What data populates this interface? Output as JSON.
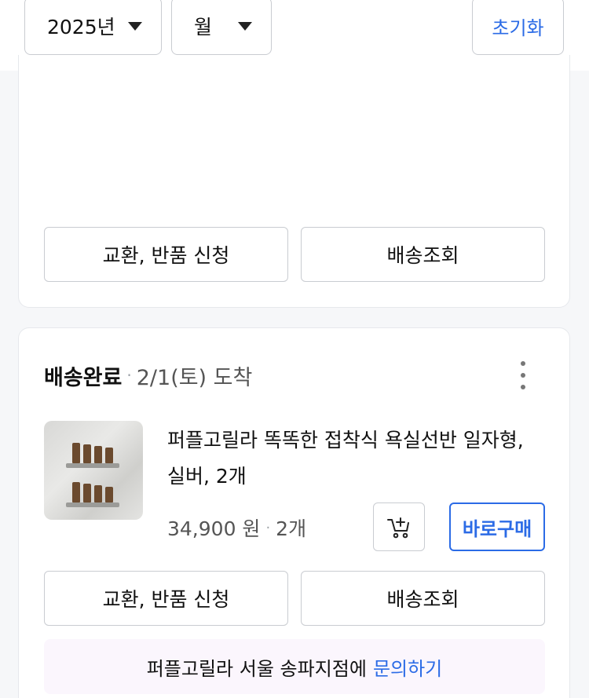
{
  "filters": {
    "year": "2025년",
    "month": "월",
    "reset_label": "초기화"
  },
  "previous_order": {
    "exchange_label": "교환, 반품 신청",
    "tracking_label": "배송조회"
  },
  "order": {
    "status": "배송완료",
    "separator": "·",
    "arrival": "2/1(토) 도착",
    "product_name": "퍼플고릴라 똑똑한 접착식 욕실선반 일자형, 실버, 2개",
    "price": "34,900 원",
    "quantity": "2개",
    "buy_now_label": "바로구매",
    "exchange_label": "교환, 반품 신청",
    "tracking_label": "배송조회",
    "inquiry_text": "퍼플고릴라 서울 송파지점에",
    "inquiry_link": "문의하기",
    "icons": [
      "chevron-down-icon",
      "kebab-menu-icon",
      "add-to-cart-icon"
    ]
  },
  "colors": {
    "accent": "#2b6be6",
    "border": "#c9ccd1",
    "inquiry_bg": "#fbf6fd",
    "page_bg": "#f6f7f9"
  }
}
